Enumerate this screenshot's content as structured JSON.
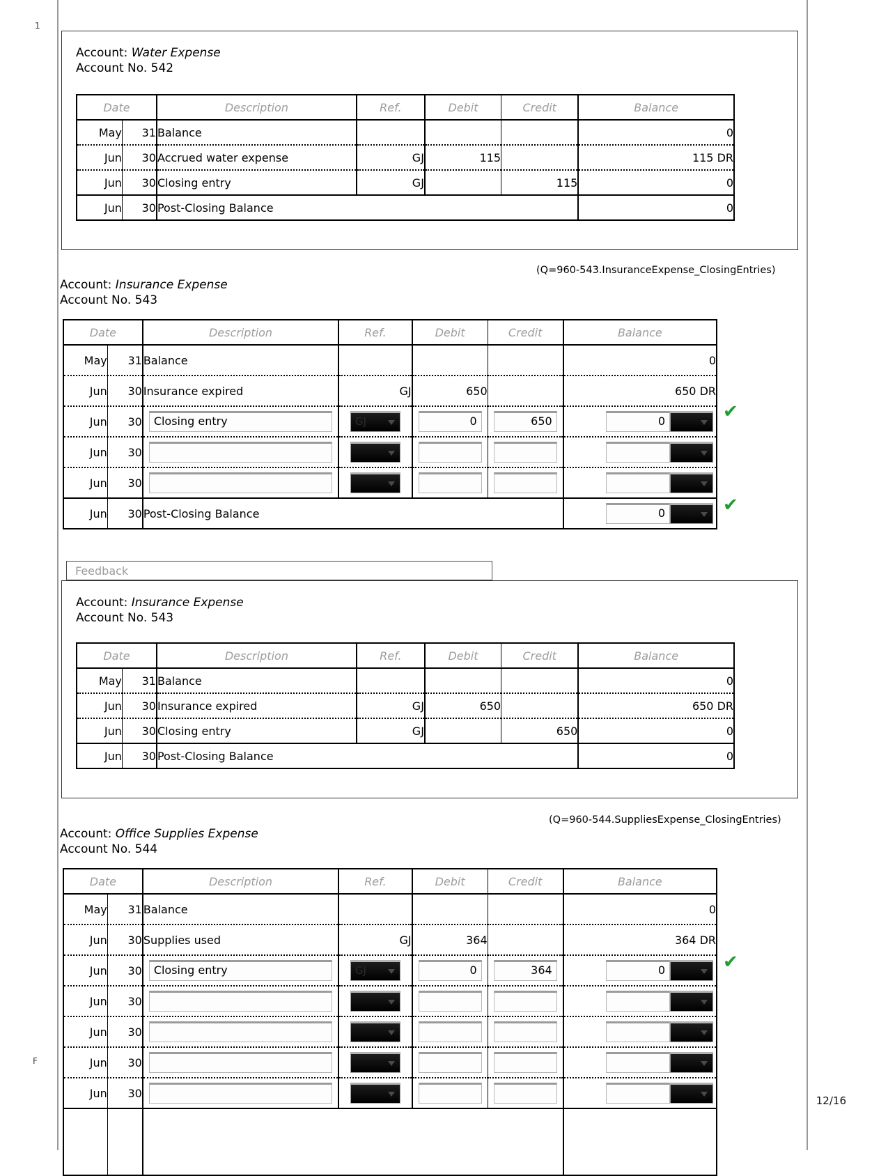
{
  "page": {
    "left_mark": "1",
    "bottom_left_mark": "F",
    "page_number": "12/16"
  },
  "icons": {
    "check": "✔",
    "dropdown_arrow": "▾"
  },
  "columns": [
    "Date",
    "Description",
    "Ref.",
    "Debit",
    "Credit",
    "Balance"
  ],
  "sections": [
    {
      "id": "water-expense-key",
      "kind": "answer-key",
      "account_label": "Account:",
      "account_name": "Water Expense",
      "account_no_label": "Account No. 542",
      "rows": [
        {
          "month": "May",
          "day": "31",
          "desc": "Balance",
          "ref": "",
          "debit": "",
          "credit": "",
          "balance": "0"
        },
        {
          "month": "Jun",
          "day": "30",
          "desc": "Accrued water expense",
          "ref": "GJ",
          "debit": "115",
          "credit": "",
          "balance": "115 DR"
        },
        {
          "month": "Jun",
          "day": "30",
          "desc": "Closing entry",
          "ref": "GJ",
          "debit": "",
          "credit": "115",
          "balance": "0"
        },
        {
          "month": "Jun",
          "day": "30",
          "desc": "Post-Closing Balance",
          "ref": "",
          "debit": "",
          "credit": "",
          "balance": "0"
        }
      ]
    },
    {
      "id": "insurance-expense-worksheet",
      "kind": "worksheet",
      "qtag": "(Q=960-543.InsuranceExpense_ClosingEntries)",
      "account_label": "Account:",
      "account_name": "Insurance Expense",
      "account_no_label": "Account No. 543",
      "rows": [
        {
          "month": "May",
          "day": "31",
          "type": "static",
          "desc": "Balance",
          "ref": "",
          "debit": "",
          "credit": "",
          "balance": "0"
        },
        {
          "month": "Jun",
          "day": "30",
          "type": "static",
          "desc": "Insurance expired",
          "ref": "GJ",
          "debit": "650",
          "credit": "",
          "balance": "650 DR"
        },
        {
          "month": "Jun",
          "day": "30",
          "type": "input",
          "desc": "Closing entry",
          "ref": "GJ",
          "debit": "0",
          "credit": "650",
          "balance": "0",
          "bal_dir": "",
          "check": true
        },
        {
          "month": "Jun",
          "day": "30",
          "type": "input",
          "desc": "",
          "ref": "",
          "debit": "",
          "credit": "",
          "balance": "",
          "bal_dir": "",
          "check": false
        },
        {
          "month": "Jun",
          "day": "30",
          "type": "input",
          "desc": "",
          "ref": "",
          "debit": "",
          "credit": "",
          "balance": "",
          "bal_dir": "",
          "check": false
        },
        {
          "month": "Jun",
          "day": "30",
          "type": "total",
          "desc": "Post-Closing Balance",
          "balance": "0",
          "bal_dir": "",
          "check": true
        }
      ]
    },
    {
      "id": "insurance-expense-key",
      "kind": "answer-key",
      "account_label": "Account:",
      "account_name": "Insurance Expense",
      "account_no_label": "Account No. 543",
      "rows": [
        {
          "month": "May",
          "day": "31",
          "desc": "Balance",
          "ref": "",
          "debit": "",
          "credit": "",
          "balance": "0"
        },
        {
          "month": "Jun",
          "day": "30",
          "desc": "Insurance expired",
          "ref": "GJ",
          "debit": "650",
          "credit": "",
          "balance": "650 DR"
        },
        {
          "month": "Jun",
          "day": "30",
          "desc": "Closing entry",
          "ref": "GJ",
          "debit": "",
          "credit": "650",
          "balance": "0"
        },
        {
          "month": "Jun",
          "day": "30",
          "desc": "Post-Closing Balance",
          "ref": "",
          "debit": "",
          "credit": "",
          "balance": "0"
        }
      ]
    },
    {
      "id": "office-supplies-expense-worksheet",
      "kind": "worksheet",
      "qtag": "(Q=960-544.SuppliesExpense_ClosingEntries)",
      "account_label": "Account:",
      "account_name": "Office Supplies Expense",
      "account_no_label": "Account No. 544",
      "rows": [
        {
          "month": "May",
          "day": "31",
          "type": "static",
          "desc": "Balance",
          "ref": "",
          "debit": "",
          "credit": "",
          "balance": "0"
        },
        {
          "month": "Jun",
          "day": "30",
          "type": "static",
          "desc": "Supplies used",
          "ref": "GJ",
          "debit": "364",
          "credit": "",
          "balance": "364 DR"
        },
        {
          "month": "Jun",
          "day": "30",
          "type": "input",
          "desc": "Closing entry",
          "ref": "GJ",
          "debit": "0",
          "credit": "364",
          "balance": "0",
          "check": true
        },
        {
          "month": "Jun",
          "day": "30",
          "type": "input",
          "desc": "",
          "ref": "",
          "debit": "",
          "credit": "",
          "balance": "",
          "check": false
        },
        {
          "month": "Jun",
          "day": "30",
          "type": "input",
          "desc": "",
          "ref": "",
          "debit": "",
          "credit": "",
          "balance": "",
          "check": false
        },
        {
          "month": "Jun",
          "day": "30",
          "type": "input",
          "desc": "",
          "ref": "",
          "debit": "",
          "credit": "",
          "balance": "",
          "check": false
        },
        {
          "month": "Jun",
          "day": "30",
          "type": "input",
          "desc": "",
          "ref": "",
          "debit": "",
          "credit": "",
          "balance": "",
          "check": false
        }
      ]
    }
  ],
  "feedback": {
    "placeholder": "Feedback"
  }
}
